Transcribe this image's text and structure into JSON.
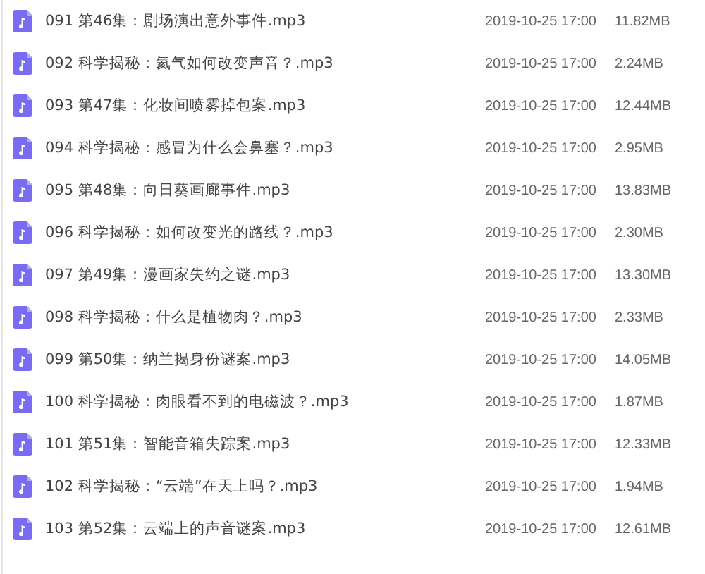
{
  "files": [
    {
      "name": "091 第46集：剧场演出意外事件.mp3",
      "modified": "2019-10-25 17:00",
      "size": "11.82MB"
    },
    {
      "name": "092 科学揭秘：氦气如何改变声音？.mp3",
      "modified": "2019-10-25 17:00",
      "size": "2.24MB"
    },
    {
      "name": "093 第47集：化妆间喷雾掉包案.mp3",
      "modified": "2019-10-25 17:00",
      "size": "12.44MB"
    },
    {
      "name": "094 科学揭秘：感冒为什么会鼻塞？.mp3",
      "modified": "2019-10-25 17:00",
      "size": "2.95MB"
    },
    {
      "name": "095 第48集：向日葵画廊事件.mp3",
      "modified": "2019-10-25 17:00",
      "size": "13.83MB"
    },
    {
      "name": "096 科学揭秘：如何改变光的路线？.mp3",
      "modified": "2019-10-25 17:00",
      "size": "2.30MB"
    },
    {
      "name": "097 第49集：漫画家失约之谜.mp3",
      "modified": "2019-10-25 17:00",
      "size": "13.30MB"
    },
    {
      "name": "098 科学揭秘：什么是植物肉？.mp3",
      "modified": "2019-10-25 17:00",
      "size": "2.33MB"
    },
    {
      "name": "099 第50集：纳兰揭身份谜案.mp3",
      "modified": "2019-10-25 17:00",
      "size": "14.05MB"
    },
    {
      "name": "100 科学揭秘：肉眼看不到的电磁波？.mp3",
      "modified": "2019-10-25 17:00",
      "size": "1.87MB"
    },
    {
      "name": "101 第51集：智能音箱失踪案.mp3",
      "modified": "2019-10-25 17:00",
      "size": "12.33MB"
    },
    {
      "name": "102 科学揭秘：“云端”在天上吗？.mp3",
      "modified": "2019-10-25 17:00",
      "size": "1.94MB"
    },
    {
      "name": "103 第52集：云端上的声音谜案.mp3",
      "modified": "2019-10-25 17:00",
      "size": "12.61MB"
    }
  ]
}
